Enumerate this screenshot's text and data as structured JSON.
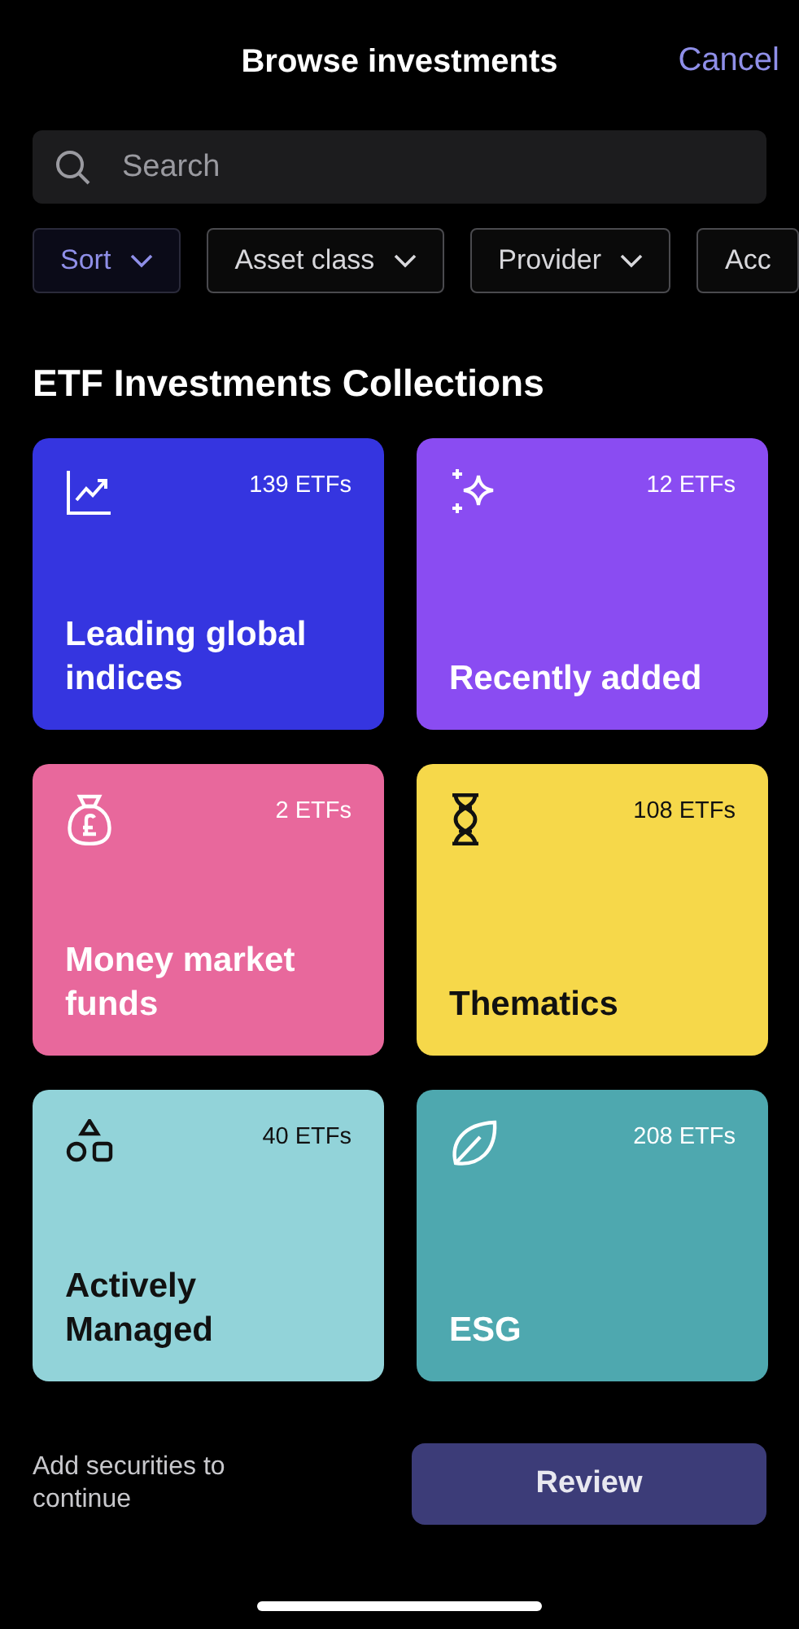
{
  "header": {
    "title": "Browse investments",
    "cancel": "Cancel"
  },
  "search": {
    "placeholder": "Search"
  },
  "filters": [
    {
      "label": "Sort",
      "selected": true
    },
    {
      "label": "Asset class",
      "selected": false
    },
    {
      "label": "Provider",
      "selected": false
    },
    {
      "label": "Acc",
      "selected": false
    }
  ],
  "section_title": "ETF Investments Collections",
  "collections": [
    {
      "title": "Leading global indices",
      "count": "139 ETFs",
      "color": "#3535e0",
      "dark_text": false
    },
    {
      "title": "Recently added",
      "count": "12 ETFs",
      "color": "#8a4cf2",
      "dark_text": false
    },
    {
      "title": "Money market funds",
      "count": "2 ETFs",
      "color": "#e8689c",
      "dark_text": false
    },
    {
      "title": "Thematics",
      "count": "108 ETFs",
      "color": "#f6d84a",
      "dark_text": true
    },
    {
      "title": "Actively Managed",
      "count": "40 ETFs",
      "color": "#92d3d9",
      "dark_text": true
    },
    {
      "title": "ESG",
      "count": "208 ETFs",
      "color": "#4ea8af",
      "dark_text": false
    }
  ],
  "footer": {
    "hint": "Add securities to continue",
    "button": {
      "label": "Review",
      "disabled": true
    }
  }
}
